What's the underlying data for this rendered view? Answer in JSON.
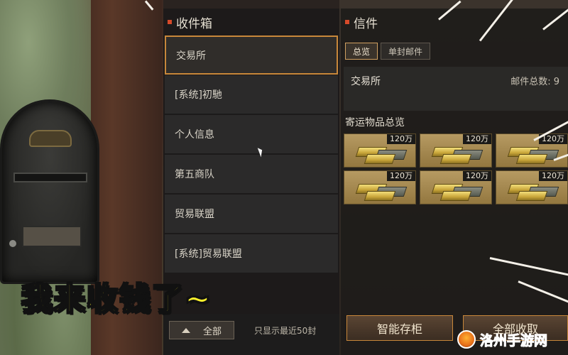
{
  "inbox": {
    "title": "收件箱",
    "items": [
      {
        "label": "交易所",
        "selected": true
      },
      {
        "label": "[系统]初馳",
        "selected": false
      },
      {
        "label": "个人信息",
        "selected": false
      },
      {
        "label": "第五商队",
        "selected": false
      },
      {
        "label": "贸易联盟",
        "selected": false
      },
      {
        "label": "[系统]贸易联盟",
        "selected": false
      }
    ],
    "filter_label": "全部",
    "footer_note": "只显示最近50封"
  },
  "mail": {
    "title": "信件",
    "tabs": [
      {
        "label": "总览",
        "active": true
      },
      {
        "label": "单封邮件",
        "active": false
      }
    ],
    "sender": "交易所",
    "count_label": "邮件总数:",
    "count_value": "9",
    "section_title": "寄运物品总览",
    "items": [
      {
        "amount": "120万",
        "icon": "gold-bars-icon"
      },
      {
        "amount": "120万",
        "icon": "gold-bars-icon"
      },
      {
        "amount": "120万",
        "icon": "gold-bars-icon"
      },
      {
        "amount": "120万",
        "icon": "gold-bars-icon"
      },
      {
        "amount": "120万",
        "icon": "gold-bars-icon"
      },
      {
        "amount": "120万",
        "icon": "gold-bars-icon"
      }
    ],
    "smart_store_label": "智能存柜",
    "collect_all_label": "全部收取"
  },
  "caption": "我来收钱了~",
  "watermark": "洛州手游网",
  "colors": {
    "accent": "#c8873a",
    "title_dot": "#d74a2a",
    "caption": "#fff22c"
  }
}
